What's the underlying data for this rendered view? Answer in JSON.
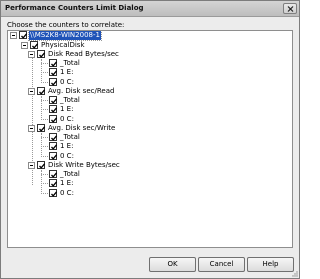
{
  "window": {
    "title": "Performance Counters Limit Dialog"
  },
  "prompt": "Choose the counters to correlate:",
  "tree": {
    "root": "\\\\MS2K8-WIN2008-1",
    "category": "PhysicalDisk",
    "counters": [
      {
        "label": "Disk Read Bytes/sec",
        "instances": [
          "_Total",
          "1 E:",
          "0 C:"
        ]
      },
      {
        "label": "Avg. Disk sec/Read",
        "instances": [
          "_Total",
          "1 E:",
          "0 C:"
        ]
      },
      {
        "label": "Avg. Disk sec/Write",
        "instances": [
          "_Total",
          "1 E:",
          "0 C:"
        ]
      },
      {
        "label": "Disk Write Bytes/sec",
        "instances": [
          "_Total",
          "1 E:",
          "0 C:"
        ]
      }
    ]
  },
  "buttons": {
    "ok": "OK",
    "cancel": "Cancel",
    "help": "Help"
  }
}
